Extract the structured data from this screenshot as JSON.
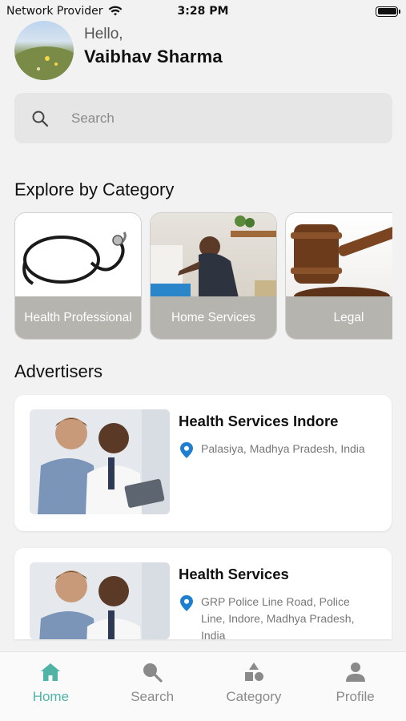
{
  "status_bar": {
    "carrier": "Network Provider",
    "time": "3:28 PM"
  },
  "greeting": {
    "hello": "Hello,",
    "name": "Vaibhav Sharma"
  },
  "search": {
    "placeholder": "Search"
  },
  "categories_section": {
    "title": "Explore by Category",
    "items": [
      {
        "label": "Health Professional",
        "icon": "stethoscope"
      },
      {
        "label": "Home Services",
        "icon": "repair-worker"
      },
      {
        "label": "Legal",
        "icon": "gavel"
      }
    ]
  },
  "advertisers_section": {
    "title": "Advertisers",
    "items": [
      {
        "title": "Health Services Indore",
        "address": "Palasiya, Madhya Pradesh, India",
        "icon": "location-pin-icon"
      },
      {
        "title": "Health Services",
        "address": "GRP Police Line Road, Police Line, Indore, Madhya Pradesh, India",
        "icon": "location-pin-icon"
      }
    ]
  },
  "bottom_nav": {
    "items": [
      {
        "label": "Home",
        "icon": "home-icon",
        "active": true
      },
      {
        "label": "Search",
        "icon": "search-icon",
        "active": false
      },
      {
        "label": "Category",
        "icon": "category-icon",
        "active": false
      },
      {
        "label": "Profile",
        "icon": "profile-icon",
        "active": false
      }
    ]
  },
  "colors": {
    "accent": "#4fb3a6",
    "pin": "#1e7fd0",
    "category_label_bg": "#b6b4af"
  }
}
